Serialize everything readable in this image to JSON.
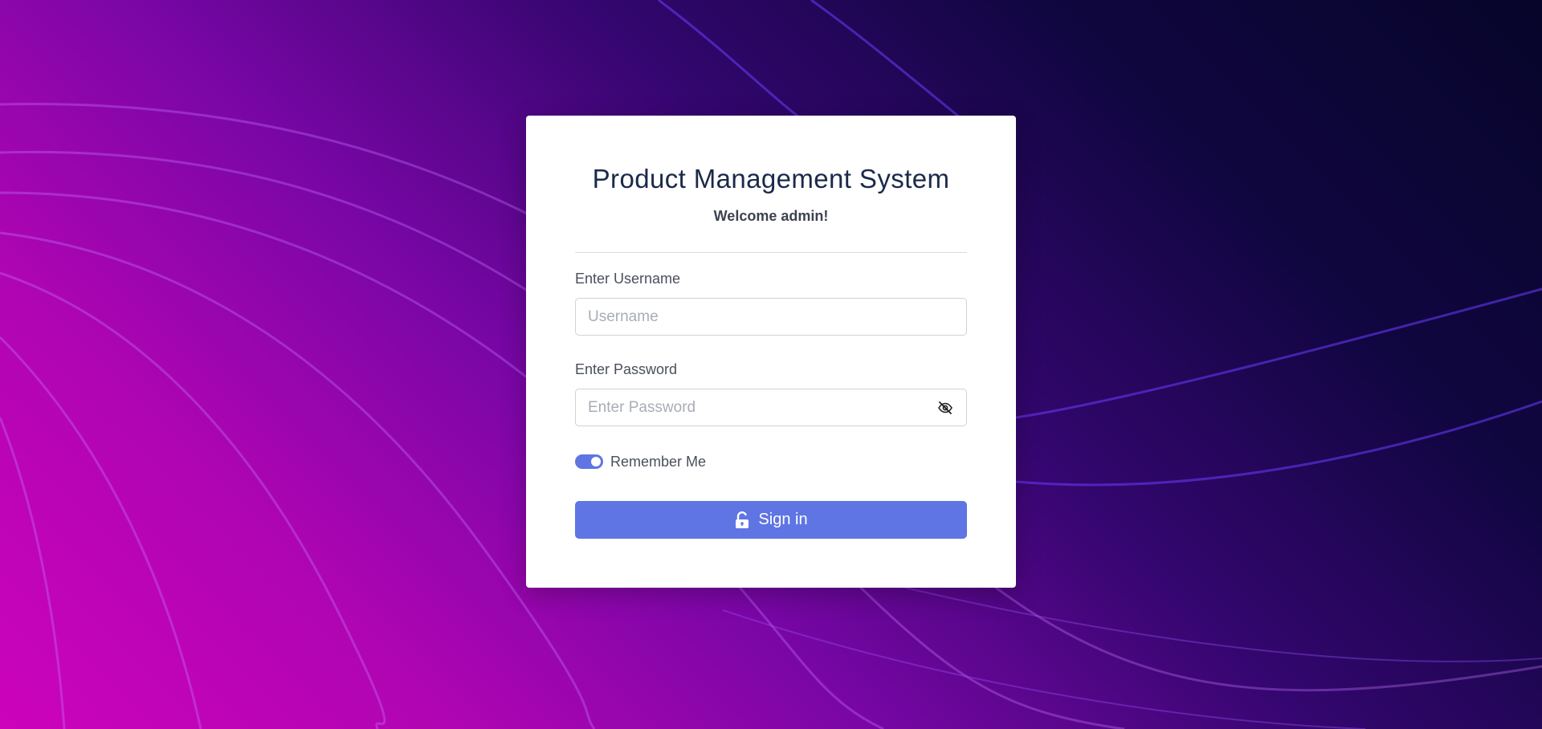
{
  "login": {
    "title": "Product Management System",
    "subtitle": "Welcome admin!",
    "username_label": "Enter Username",
    "username_placeholder": "Username",
    "username_value": "",
    "password_label": "Enter Password",
    "password_placeholder": "Enter Password",
    "password_value": "",
    "password_toggle_icon": "eye-slash-icon",
    "remember_label": "Remember Me",
    "remember_checked": true,
    "signin_icon": "unlock-icon",
    "signin_label": "Sign in"
  },
  "colors": {
    "accent": "#5f75e4",
    "title": "#1b2a4a",
    "card": "#ffffff"
  }
}
